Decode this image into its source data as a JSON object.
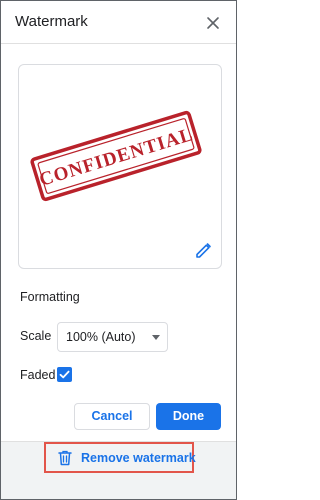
{
  "header": {
    "title": "Watermark",
    "close_icon": "close-icon"
  },
  "preview": {
    "stamp_text": "CONFIDENTIAL",
    "stamp_color": "#b9222b",
    "edit_icon": "pencil-icon"
  },
  "formatting": {
    "heading": "Formatting",
    "scale_label": "Scale",
    "scale_value": "100% (Auto)",
    "faded_label": "Faded",
    "faded_checked": true
  },
  "actions": {
    "cancel_label": "Cancel",
    "done_label": "Done"
  },
  "footer": {
    "remove_label": "Remove watermark",
    "remove_icon": "trash-icon"
  },
  "colors": {
    "accent": "#1a73e8",
    "highlight_border": "#e2554a",
    "footer_bg": "#f1f3f4"
  }
}
